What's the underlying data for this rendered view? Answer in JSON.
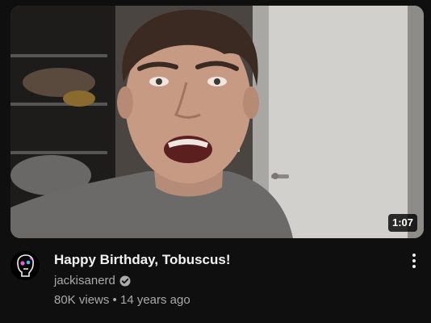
{
  "video": {
    "title": "Happy Birthday, Tobuscus!",
    "duration": "1:07",
    "channel": "jackisanerd",
    "views": "80K views",
    "separator": "•",
    "age": "14 years ago"
  },
  "icons": {
    "verified": "verified-check-icon",
    "menu": "more-vert-icon",
    "avatar": "channel-avatar"
  },
  "colors": {
    "background": "#0f0f0f",
    "title": "#f1f1f1",
    "secondary_text": "#aaaaaa"
  }
}
